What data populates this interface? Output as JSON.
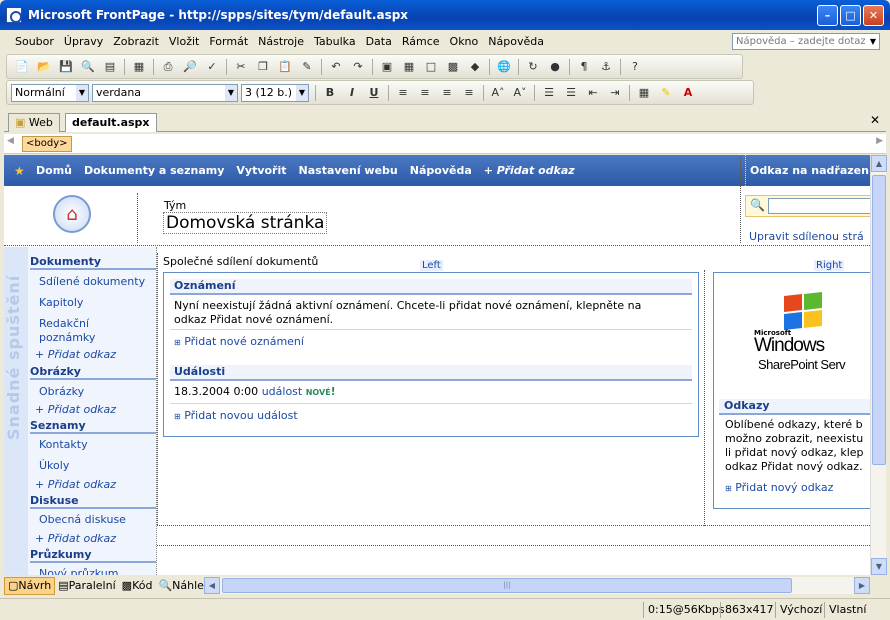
{
  "window": {
    "title": "Microsoft FrontPage - http://spps/sites/tym/default.aspx"
  },
  "menu": {
    "items": [
      "Soubor",
      "Úpravy",
      "Zobrazit",
      "Vložit",
      "Formát",
      "Nástroje",
      "Tabulka",
      "Data",
      "Rámce",
      "Okno",
      "Nápověda"
    ],
    "help_placeholder": "Nápověda – zadejte dotaz"
  },
  "format": {
    "style": "Normální",
    "font": "verdana",
    "size": "3 (12 b.)"
  },
  "tabs": {
    "web": "Web",
    "page": "default.aspx"
  },
  "tagbar": {
    "tag": "<body>"
  },
  "topnav": {
    "items": [
      "Domů",
      "Dokumenty a seznamy",
      "Vytvořit",
      "Nastavení webu",
      "Nápověda"
    ],
    "add_link": "+ Přidat odkaz",
    "upper": "Odkaz na nadřazen"
  },
  "header": {
    "site_name": "Tým",
    "page_title": "Domovská stránka",
    "edit_shared": "Upravit sdílenou strá"
  },
  "quicklaunch": {
    "vertical": "Snadné spuštění",
    "sections": [
      {
        "title": "Dokumenty",
        "items": [
          "Sdílené dokumenty",
          "Kapitoly",
          "Redakční poznámky"
        ]
      },
      {
        "title": "Obrázky",
        "items": [
          "Obrázky"
        ]
      },
      {
        "title": "Seznamy",
        "items": [
          "Kontakty",
          "Úkoly"
        ]
      },
      {
        "title": "Diskuse",
        "items": [
          "Obecná diskuse"
        ]
      },
      {
        "title": "Průzkumy",
        "items": [
          "Nový průzkum"
        ]
      }
    ],
    "add_link": "Přidat odkaz"
  },
  "main": {
    "shared_title": "Společné sdílení dokumentů",
    "left_label": "Left",
    "right_label": "Right",
    "announcements": {
      "title": "Oznámení",
      "text": "Nyní neexistují žádná aktivní oznámení. Chcete-li přidat nové oznámení, klepněte na odkaz Přidat nové oznámení.",
      "add": "Přidat nové oznámení"
    },
    "events": {
      "title": "Události",
      "date": "18.3.2004 0:00",
      "event": "událost",
      "new_badge": "NOVÉ",
      "new_mark": "!",
      "add": "Přidat novou událost"
    },
    "logo": {
      "ms": "Microsoft",
      "windows": "Windows",
      "sharepoint": "SharePoint Serv"
    },
    "links": {
      "title": "Odkazy",
      "lines": [
        "Oblíbené odkazy, které b",
        "možno zobrazit, neexistu",
        "li přidat nový odkaz, klep",
        "odkaz Přidat nový odkaz."
      ],
      "add": "Přidat nový odkaz"
    }
  },
  "views": {
    "design": "Návrh",
    "split": "Paralelní",
    "code": "Kód",
    "preview": "Náhled"
  },
  "status": {
    "speed": "0:15@56Kbps",
    "size": "863x417",
    "default": "Výchozí",
    "custom": "Vlastní"
  }
}
